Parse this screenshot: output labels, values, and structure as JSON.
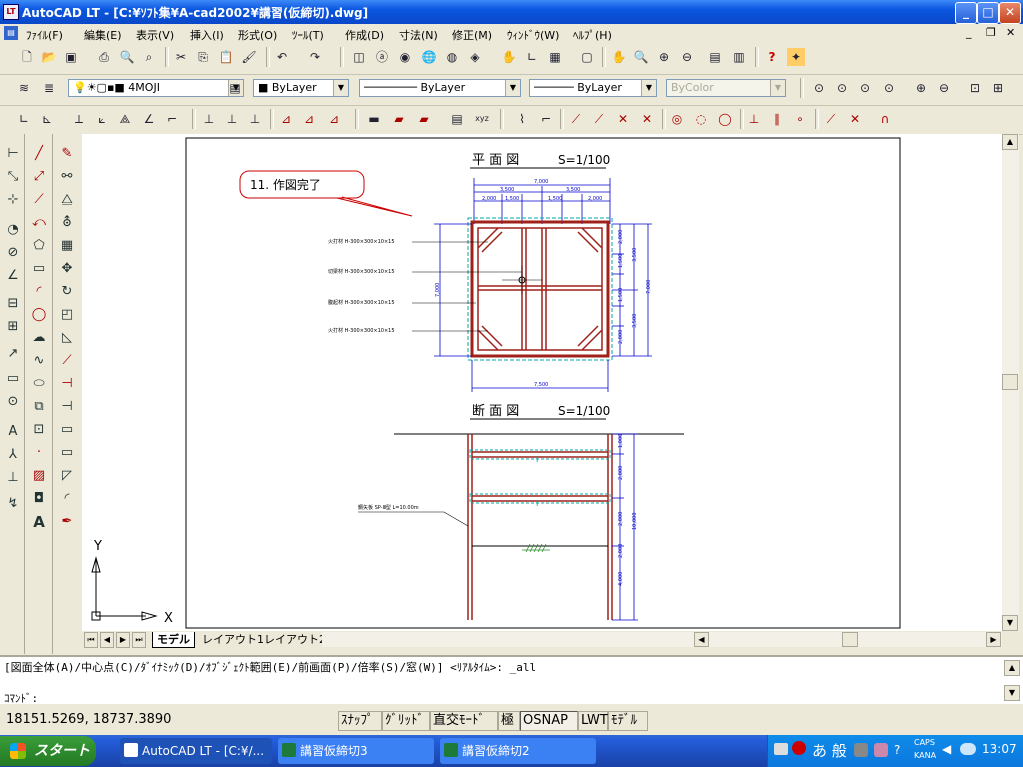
{
  "window": {
    "title": "AutoCAD LT - [C:¥ｿﾌﾄ集¥A-cad2002¥講習(仮締切).dwg]"
  },
  "menu": [
    "ﾌｧｲﾙ(F)",
    "編集(E)",
    "表示(V)",
    "挿入(I)",
    "形式(O)",
    "ﾂｰﾙ(T)",
    "作成(D)",
    "寸法(N)",
    "修正(M)",
    "ｳｨﾝﾄﾞｳ(W)",
    "ﾍﾙﾌﾟ(H)"
  ],
  "layers": {
    "current_layer": "4MOJI",
    "color": "ByLayer",
    "linetype": "ByLayer",
    "lineweight": "ByLayer",
    "plotstyle": "ByColor"
  },
  "drawing": {
    "plan_title": "平 面 図",
    "plan_scale": "S=1/100",
    "section_title": "断 面 図",
    "section_scale": "S=1/100",
    "callout": "11. 作図完了",
    "plan_dims_top": [
      "7,000",
      "3,500",
      "3,500",
      "2,000",
      "1,500",
      "1,500",
      "2,000"
    ],
    "plan_dims_bottom": "7,500",
    "plan_dims_right": [
      "2,000",
      "1,500",
      "1,500",
      "2,000",
      "3,500",
      "3,500",
      "7,000"
    ],
    "plan_dim_left": "7,000",
    "plan_labels": [
      "火打材 H-300×300×10×15",
      "切梁材 H-300×300×10×15",
      "腹起材 H-300×300×10×15",
      "火打材 H-300×300×10×15"
    ],
    "section_label": "鋼矢板 SP-Ⅲ型 L=10.00m",
    "section_dims": [
      "1,000",
      "2,000",
      "2,000",
      "2,000",
      "4,000",
      "10,000"
    ],
    "ucs_x": "X",
    "ucs_y": "Y"
  },
  "tabs": [
    "モデル",
    "レイアウト1",
    "レイアウト2"
  ],
  "command": {
    "line1": "[図面全体(A)/中心点(C)/ﾀﾞｲﾅﾐｯｸ(D)/ｵﾌﾞｼﾞｪｸﾄ範囲(E)/前画面(P)/倍率(S)/窓(W)] <ﾘｱﾙﾀｲﾑ>: _all",
    "line2": "ｺﾏﾝﾄﾞ:"
  },
  "status": {
    "coords": "18151.5269, 18737.3890",
    "buttons": [
      "ｽﾅｯﾌﾟ",
      "ｸﾞﾘｯﾄﾞ",
      "直交ﾓｰﾄﾞ",
      "極",
      "OSNAP",
      "LWT",
      "ﾓﾃﾞﾙ"
    ]
  },
  "taskbar": {
    "start": "スタート",
    "tasks": [
      "AutoCAD LT - [C:¥/...",
      "講習仮締切3",
      "講習仮締切2"
    ],
    "ime": "あ 般",
    "caps": "CAPS",
    "kana": "KANA",
    "clock": "13:07"
  },
  "colors": {
    "accent": "#0a56e0",
    "drawing_blue": "#0000cc",
    "sheet_pile": "#a0201a",
    "dashed_cyan": "#00aaaa"
  }
}
